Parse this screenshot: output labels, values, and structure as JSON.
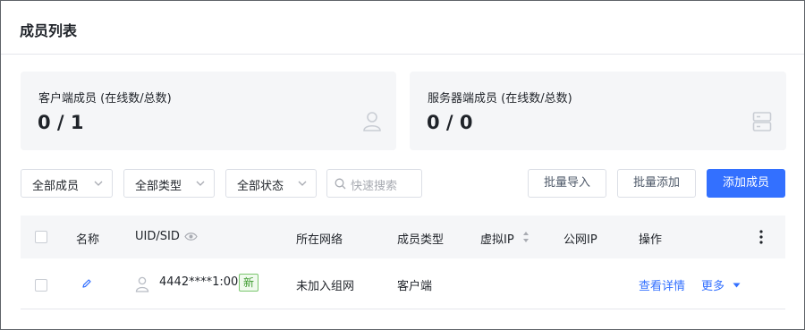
{
  "header": {
    "title": "成员列表"
  },
  "stats": {
    "client": {
      "label": "客户端成员 (在线数/总数)",
      "value": "0 / 1",
      "icon": "user-icon"
    },
    "server": {
      "label": "服务器端成员 (在线数/总数)",
      "value": "0 / 0",
      "icon": "server-icon"
    }
  },
  "filters": {
    "members": "全部成员",
    "types": "全部类型",
    "status": "全部状态",
    "search_placeholder": "快速搜索"
  },
  "actions": {
    "batch_import": "批量导入",
    "batch_add": "批量添加",
    "add_member": "添加成员"
  },
  "table": {
    "columns": [
      "名称",
      "UID/SID",
      "所在网络",
      "成员类型",
      "虚拟IP",
      "公网IP",
      "操作"
    ],
    "rows": [
      {
        "uid": "4442****1:001",
        "badge": "新",
        "network": "未加入组网",
        "type": "客户端",
        "virtual_ip": "",
        "public_ip": "",
        "view_details": "查看详情",
        "more": "更多"
      }
    ]
  },
  "colors": {
    "primary": "#3370ff",
    "new_badge": "#3c9a2e"
  }
}
